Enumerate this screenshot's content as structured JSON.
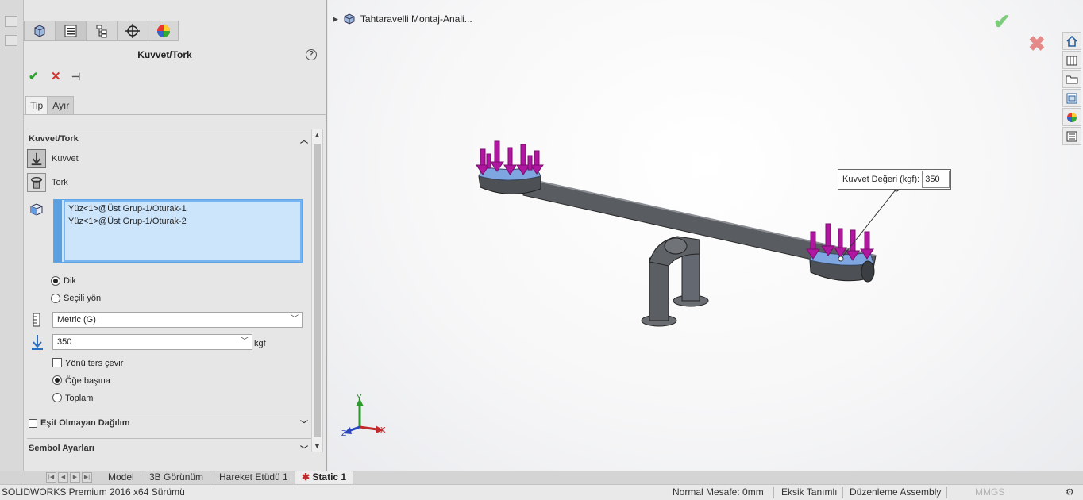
{
  "property_manager": {
    "title": "Kuvvet/Tork",
    "help": "?",
    "tabs": [
      "feature-manager",
      "property-manager",
      "configuration-manager",
      "dimxpert-manager",
      "display-manager"
    ],
    "sub_tabs": [
      "Tip",
      "Ayır"
    ],
    "section_force": {
      "title": "Kuvvet/Tork",
      "option_force": "Kuvvet",
      "option_torque": "Tork",
      "selections": [
        "Yüz<1>@Üst Grup-1/Oturak-1",
        "Yüz<1>@Üst Grup-1/Oturak-2"
      ],
      "direction_normal": "Dik",
      "direction_selected": "Seçili yön",
      "unit_system": "Metric (G)",
      "force_value": "350",
      "force_unit": "kgf",
      "reverse_direction": "Yönü ters çevir",
      "per_item": "Öğe başına",
      "total": "Toplam"
    },
    "section_nonuniform": {
      "title": "Eşit Olmayan Dağılım"
    },
    "section_symbol": {
      "title": "Sembol Ayarları"
    }
  },
  "graphics": {
    "tree_title": "Tahtaravelli Montaj-Anali...",
    "callout_label": "Kuvvet Değeri (kgf):",
    "callout_value": "350",
    "triad": {
      "x": "X",
      "y": "Y",
      "z": "Z"
    },
    "colors": {
      "arrow": "#b0169f",
      "face": "#7ea6e0",
      "beam": "#55585c"
    }
  },
  "bottom_tabs": [
    "Model",
    "3B Görünüm",
    "Hareket Etüdü 1",
    "Static 1"
  ],
  "status_bar": {
    "product": "SOLIDWORKS Premium 2016 x64 Sürümü",
    "distance": "Normal Mesafe: 0mm",
    "definition": "Eksik Tanımlı",
    "mode": "Düzenleme Assembly",
    "units": "MMGS"
  }
}
